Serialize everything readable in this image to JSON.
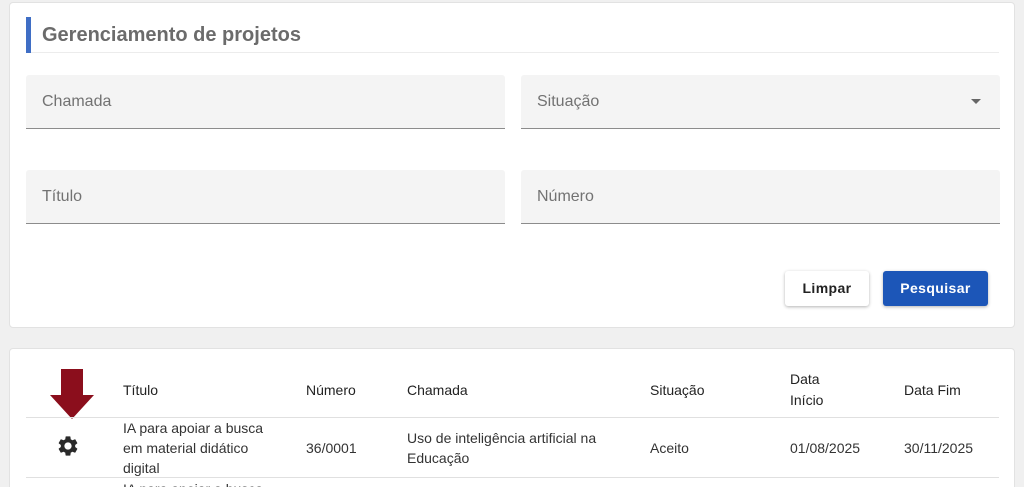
{
  "page_title": "Gerenciamento de projetos",
  "filters": {
    "chamada": {
      "label": "Chamada"
    },
    "situacao": {
      "label": "Situação"
    },
    "titulo": {
      "label": "Título"
    },
    "numero": {
      "label": "Número"
    }
  },
  "buttons": {
    "limpar": "Limpar",
    "pesquisar": "Pesquisar"
  },
  "table": {
    "headers": {
      "titulo": "Título",
      "numero": "Número",
      "chamada": "Chamada",
      "situacao": "Situação",
      "data_inicio_1": "Data",
      "data_inicio_2": "Início",
      "data_fim": "Data Fim"
    },
    "rows": [
      {
        "titulo_1": "IA para apoiar a busca",
        "titulo_2": "em material didático",
        "titulo_3": "digital",
        "numero": "36/0001",
        "chamada_1": "Uso de inteligência artificial na",
        "chamada_2": "Educação",
        "situacao": "Aceito",
        "data_inicio": "01/08/2025",
        "data_fim": "30/11/2025"
      },
      {
        "titulo_1": "IA para apoiar a busca"
      }
    ]
  },
  "icons": {
    "row_action": "gear-icon",
    "pointer": "arrow-down-icon"
  },
  "colors": {
    "accent": "#3f6ec5",
    "primary_button": "#1c56b8",
    "arrow": "#8b0e1c"
  }
}
